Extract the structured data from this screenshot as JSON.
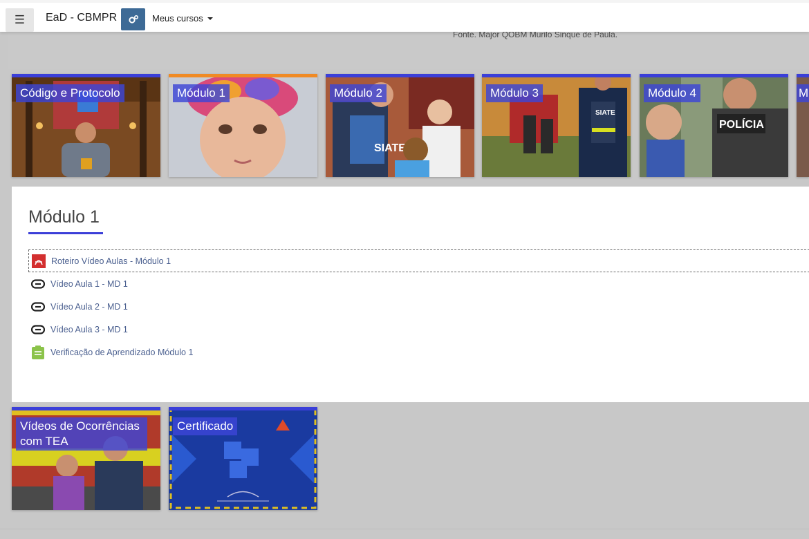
{
  "navbar": {
    "menu_icon": "hamburger-icon",
    "brand": "EaD - CBMPR",
    "settings_icon": "gears-icon",
    "courses_menu": "Meus cursos"
  },
  "source_caption": "Fonte.  Major QOBM Murilo Sinque de Paula.",
  "tiles_top": [
    {
      "label": "Código e Protocolo"
    },
    {
      "label": "Módulo 1"
    },
    {
      "label": "Módulo 2"
    },
    {
      "label": "Módulo 3"
    },
    {
      "label": "Módulo 4"
    },
    {
      "label": "M"
    }
  ],
  "tile_image_text": {
    "siate_vest": "SIATE",
    "siate_jacket": "SIATE",
    "policia": "POLÍCIA"
  },
  "section": {
    "title": "Módulo 1",
    "activities": [
      {
        "icon": "pdf-icon",
        "label": "Roteiro Vídeo Aulas - Módulo 1"
      },
      {
        "icon": "link-icon",
        "label": "Vídeo Aula 1 - MD 1"
      },
      {
        "icon": "link-icon",
        "label": "Vídeo Aula 2 - MD 1"
      },
      {
        "icon": "link-icon",
        "label": "Vídeo Aula 3 - MD 1"
      },
      {
        "icon": "quiz-icon",
        "label": "Verificação de Aprendizado Módulo 1"
      }
    ]
  },
  "tiles_bottom": [
    {
      "label": "Vídeos de Ocorrências com TEA"
    },
    {
      "label": "Certificado"
    }
  ],
  "colors": {
    "accent": "#3b3fd8",
    "settings_button": "#3d6a96",
    "link_text": "#4a5f8f",
    "pdf_red": "#d32f2f",
    "quiz_green": "#8bc34a"
  }
}
